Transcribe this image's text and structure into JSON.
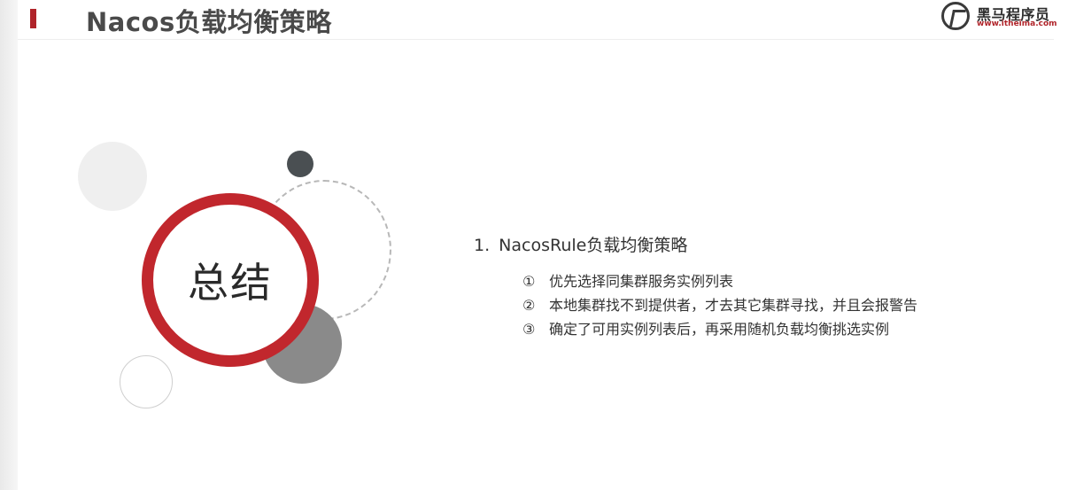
{
  "slide": {
    "title": "Nacos负载均衡策略",
    "logo": {
      "name": "黑马程序员",
      "url": "www.itheima.com"
    },
    "center_label": "总结",
    "heading": {
      "number": "1.",
      "text": "NacosRule负载均衡策略"
    },
    "items": [
      {
        "marker": "①",
        "text": "优先选择同集群服务实例列表"
      },
      {
        "marker": "②",
        "text": "本地集群找不到提供者，才去其它集群寻找，并且会报警告"
      },
      {
        "marker": "③",
        "text": "确定了可用实例列表后，再采用随机负载均衡挑选实例"
      }
    ]
  },
  "colors": {
    "accent": "#c1272d",
    "title_text": "#4a4a4a",
    "body_text": "#333333"
  }
}
